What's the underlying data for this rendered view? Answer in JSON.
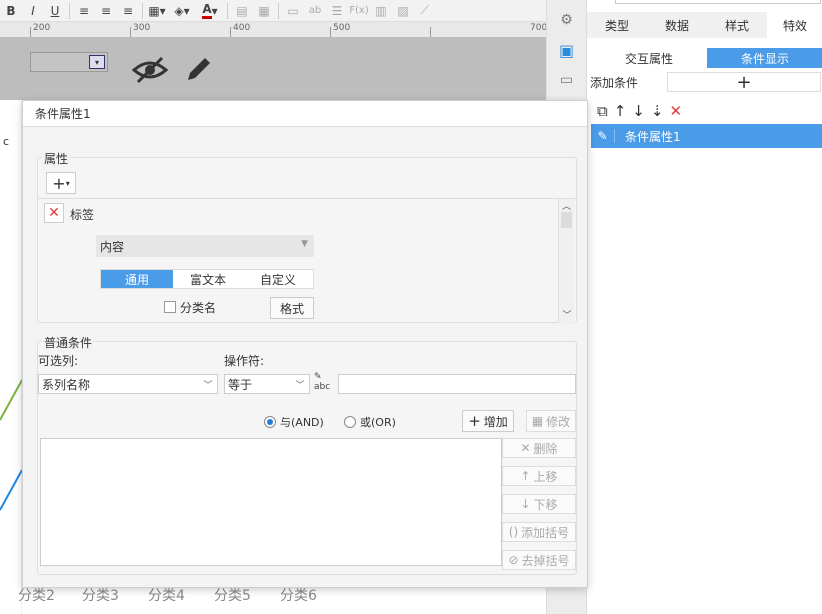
{
  "toolbar": {
    "bold": "B",
    "italic": "I",
    "underline": "U",
    "font_color_glyph": "A",
    "fx": "F(x)",
    "ab": "ab"
  },
  "ruler": {
    "marks": [
      "200",
      "300",
      "400",
      "500",
      "700"
    ]
  },
  "right_panel": {
    "tabs": [
      "类型",
      "数据",
      "样式",
      "特效"
    ],
    "subtabs": [
      "交互属性",
      "条件显示"
    ],
    "add_condition_label": "添加条件",
    "add_button": "+",
    "selected_item": "条件属性1"
  },
  "dialog": {
    "title": "条件属性1",
    "props_legend": "属性",
    "add_glyph": "+",
    "prop_item": "标签",
    "content_select": "内容",
    "content_tabs": [
      "通用",
      "富文本",
      "自定义"
    ],
    "category_checkbox": "分类名",
    "format_button": "格式",
    "cond_legend": "普通条件",
    "col_label": "可选列:",
    "op_label": "操作符:",
    "col_value": "系列名称",
    "op_value": "等于",
    "value_input": "",
    "and_label": "与(AND)",
    "or_label": "或(OR)",
    "add_btn": "增加",
    "edit_btn": "修改",
    "del_btn": "删除",
    "up_btn": "上移",
    "down_btn": "下移",
    "add_paren": "添加括号",
    "remove_paren": "去掉括号"
  },
  "background": {
    "left_col_label": "c",
    "categories": [
      "分类2",
      "分类3",
      "分类4",
      "分类5",
      "分类6"
    ]
  },
  "colors": {
    "accent": "#4a9be8",
    "selected_tab": "#4a9be8",
    "red": "#e23b3b"
  }
}
